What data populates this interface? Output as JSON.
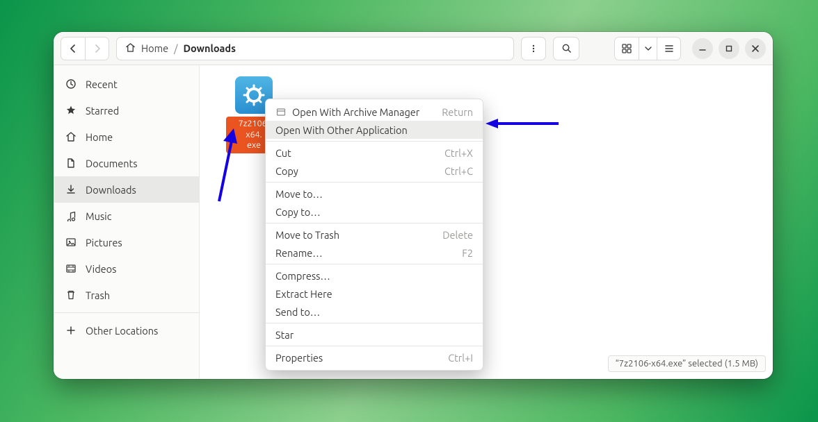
{
  "breadcrumbs": {
    "home": "Home",
    "current": "Downloads"
  },
  "sidebar": {
    "items": [
      {
        "label": "Recent"
      },
      {
        "label": "Starred"
      },
      {
        "label": "Home"
      },
      {
        "label": "Documents"
      },
      {
        "label": "Downloads"
      },
      {
        "label": "Music"
      },
      {
        "label": "Pictures"
      },
      {
        "label": "Videos"
      },
      {
        "label": "Trash"
      }
    ],
    "other": "Other Locations"
  },
  "file": {
    "name": "7z2106-x64.\nexe"
  },
  "menu": {
    "items": [
      {
        "label": "Open With Archive Manager",
        "accel": "Return",
        "icon": true
      },
      {
        "label": "Open With Other Application",
        "hover": true
      },
      {
        "sep": true
      },
      {
        "label": "Cut",
        "accel": "Ctrl+X"
      },
      {
        "label": "Copy",
        "accel": "Ctrl+C"
      },
      {
        "sep": true
      },
      {
        "label": "Move to…"
      },
      {
        "label": "Copy to…"
      },
      {
        "sep": true
      },
      {
        "label": "Move to Trash",
        "accel": "Delete"
      },
      {
        "label": "Rename…",
        "accel": "F2"
      },
      {
        "sep": true
      },
      {
        "label": "Compress…"
      },
      {
        "label": "Extract Here"
      },
      {
        "label": "Send to…"
      },
      {
        "sep": true
      },
      {
        "label": "Star"
      },
      {
        "sep": true
      },
      {
        "label": "Properties",
        "accel": "Ctrl+I"
      }
    ]
  },
  "statusbar": "“7z2106-x64.exe” selected  (1.5 MB)"
}
